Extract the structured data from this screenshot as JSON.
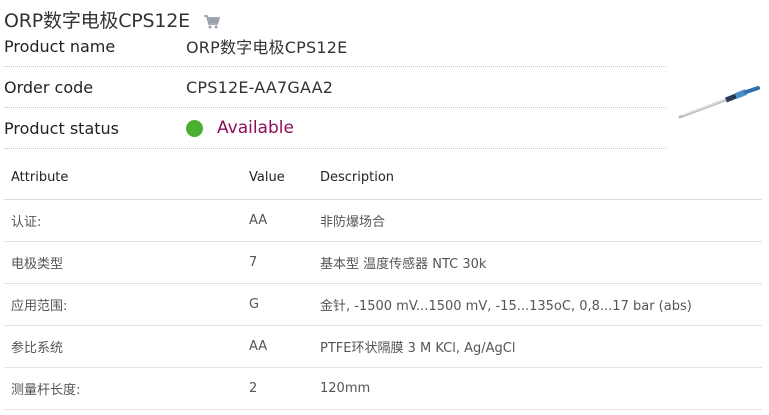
{
  "header": {
    "title": "ORP数字电极CPS12E",
    "cart_icon": "shopping-cart-icon"
  },
  "info": {
    "product_name_label": "Product name",
    "product_name_value": "ORP数字电极CPS12E",
    "order_code_label": "Order code",
    "order_code_value": "CPS12E-AA7GAA2",
    "status_label": "Product status",
    "status_value": "Available",
    "status_color": "#4caf32",
    "status_text_color": "#8b0f57"
  },
  "table": {
    "headers": [
      "Attribute",
      "Value",
      "Description"
    ],
    "rows": [
      {
        "attribute": "认证:",
        "value": "AA",
        "description": "非防爆场合"
      },
      {
        "attribute": "电极类型",
        "value": "7",
        "description": "基本型 温度传感器 NTC 30k"
      },
      {
        "attribute": "应用范围:",
        "value": "G",
        "description": "金针, -1500 mV...1500 mV, -15...135oC, 0,8...17 bar (abs)"
      },
      {
        "attribute": "参比系统",
        "value": "AA",
        "description": "PTFE环状隔膜 3 M KCl, Ag/AgCl"
      },
      {
        "attribute": "测量杆长度:",
        "value": "2",
        "description": "120mm"
      }
    ]
  }
}
